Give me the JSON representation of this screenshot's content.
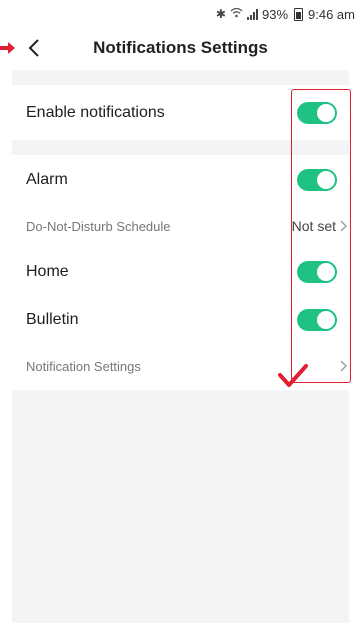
{
  "status_bar": {
    "battery": "93%",
    "time": "9:46 am"
  },
  "header": {
    "title": "Notifications Settings"
  },
  "settings": {
    "enable_notifications": {
      "label": "Enable notifications",
      "enabled": true
    },
    "alarm": {
      "label": "Alarm",
      "enabled": true
    },
    "dnd_schedule": {
      "label": "Do-Not-Disturb Schedule",
      "value": "Not set"
    },
    "home": {
      "label": "Home",
      "enabled": true
    },
    "bulletin": {
      "label": "Bulletin",
      "enabled": true
    },
    "notification_settings": {
      "label": "Notification Settings"
    }
  },
  "colors": {
    "toggle_on": "#1fc283",
    "annotation": "#e0202e"
  }
}
